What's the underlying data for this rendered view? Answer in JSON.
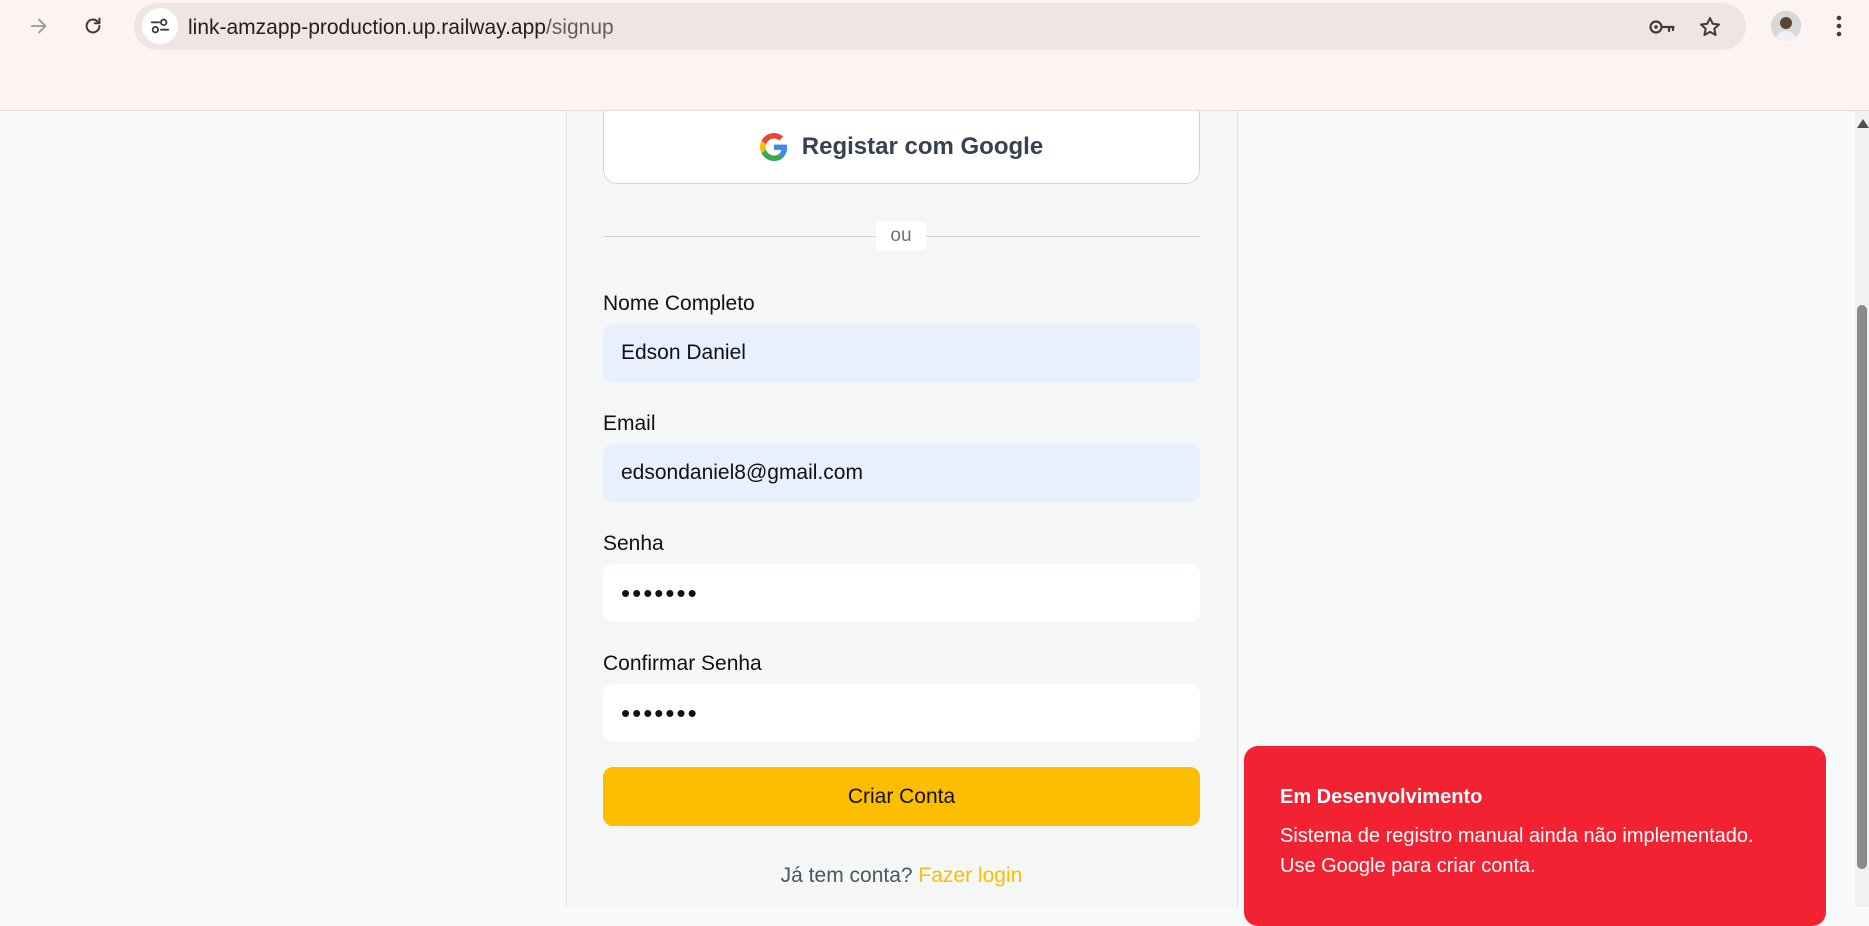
{
  "browser": {
    "url_host": "link-amzapp-production.up.railway.app",
    "url_path": "/signup",
    "icons": {
      "forward": "forward-arrow-icon",
      "reload": "reload-icon",
      "site_info": "site-info-icon",
      "password_key": "key-icon",
      "bookmark": "star-icon",
      "profile": "profile-avatar",
      "menu": "kebab-menu-icon"
    }
  },
  "signup": {
    "google_button_label": "Registar com Google",
    "divider_text": "ou",
    "full_name": {
      "label": "Nome Completo",
      "value": "Edson Daniel"
    },
    "email": {
      "label": "Email",
      "value": "edsondaniel8@gmail.com"
    },
    "password": {
      "label": "Senha",
      "value": "•••••••"
    },
    "confirm_password": {
      "label": "Confirmar Senha",
      "value": "•••••••"
    },
    "submit_label": "Criar Conta",
    "footer_prompt": "Já tem conta?",
    "footer_link": "Fazer login"
  },
  "toast": {
    "title": "Em Desenvolvimento",
    "message": "Sistema de registro manual ainda não implementado. Use Google para criar conta."
  },
  "colors": {
    "accent_yellow": "#fdbd00",
    "toast_red": "#f22232",
    "autofill_blue": "#e8f0fe"
  }
}
